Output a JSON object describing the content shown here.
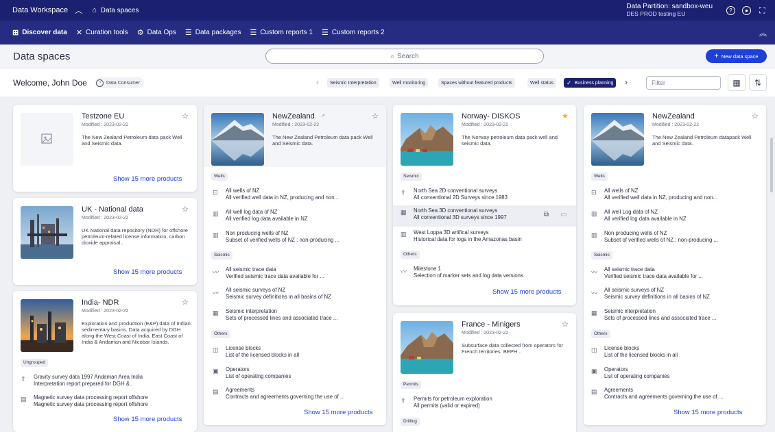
{
  "topbar": {
    "app_name": "Data Workspace",
    "breadcrumb": "Data spaces",
    "partition_line1": "Data Partition: sandbox-weu",
    "partition_line2": "DES PROD testing EU"
  },
  "nav": {
    "items": [
      {
        "label": "Discover data",
        "icon": "grid-icon"
      },
      {
        "label": "Curation tools",
        "icon": "tools-icon"
      },
      {
        "label": "Data Ops",
        "icon": "gears-icon"
      },
      {
        "label": "Data packages",
        "icon": "list-icon"
      },
      {
        "label": "Custom reports 1",
        "icon": "list-icon"
      },
      {
        "label": "Custom reports 2",
        "icon": "list-icon"
      }
    ]
  },
  "header": {
    "title": "Data spaces",
    "search_placeholder": "Search",
    "new_button": "New data space"
  },
  "welcome": {
    "greeting": "Welcome, John Doe",
    "role": "Data Consumer",
    "filter_placeholder": "Filter",
    "chips": [
      "Seismic Interpretation",
      "Well monitoring",
      "Spaces without featured products",
      "Well status",
      "Business planning"
    ]
  },
  "colors": {
    "topbar": "#1b2170",
    "navbar": "#252c82",
    "accent": "#1e3fd8",
    "star_favorite": "#f5b400"
  },
  "cards": {
    "testzone": {
      "title": "Testzone EU",
      "modified": "Modified : 2023-02-22",
      "desc": "The New Zealand Petroleum data pack Well and Seismic data.",
      "show_more": "Show 15 more products"
    },
    "uk": {
      "title": "UK - National data",
      "modified": "Modified : 2023-02-22",
      "desc": "UK National data repository (NDR) for offshore petroleum-related license information, carbon dioxide appraisal..",
      "show_more": "Show 15 more products"
    },
    "india": {
      "title": "India- NDR",
      "modified": "Modified : 2023-02-22",
      "desc": "Exploration and production (E&P) data of Indian sedimentary basins. Data acquired by DGH along the West Coast of India, East Coast of India & Andaman and Nicobar Islands.",
      "section": "Ungrouped",
      "products": [
        {
          "title": "Gravity survey data 1997 Andaman Area India",
          "sub": "Interpretation report prepared for DGH &.."
        },
        {
          "title": "Magnetic survey data processing report offshore",
          "sub": "Magnetic survey data processing report offshore"
        }
      ],
      "show_more": "Show 15 more products"
    },
    "nz1": {
      "title": "NewZealand",
      "modified": "Modified : 2023-02-22",
      "desc": "The New Zealand Petroleum data pack Well and Seismic data.",
      "sections": {
        "wells": "Wells",
        "seismic": "Seismic",
        "others": "Others"
      },
      "wells": [
        {
          "title": "All wells of NZ",
          "sub": "All verified well data in NZ, producing and non..."
        },
        {
          "title": "All well log data of NZ",
          "sub": "All verified log data available in NZ"
        },
        {
          "title": "Non producing wells of NZ",
          "sub": "Subset of verified wells of NZ : non-producing ..."
        }
      ],
      "seismic": [
        {
          "title": "All seismic trace data",
          "sub": "Verified seismic trace data available for ..."
        },
        {
          "title": "All seismic surveys of NZ",
          "sub": "Seismic survey definitions in all basins of NZ"
        },
        {
          "title": "Seismic interpretation",
          "sub": "Sets of processed lines and associated trace ..."
        }
      ],
      "others": [
        {
          "title": "License blocks",
          "sub": "List of the licensed blocks in all"
        },
        {
          "title": "Operators",
          "sub": "List of operating companies"
        },
        {
          "title": "Agreements",
          "sub": "Contracts and agreements governing the use of ..."
        }
      ],
      "show_more": "Show 15 more products"
    },
    "norway": {
      "title": "Norway- DISKOS",
      "modified": "Modified : 2023-02-22",
      "desc": "The Norway petroleum data pack well and seismic data.",
      "sections": {
        "seismic": "Seismic",
        "others": "Others"
      },
      "seismic": [
        {
          "title": "North Sea 2D conventional surveys",
          "sub": "All conventional 2D Surveys since 1983"
        },
        {
          "title": "North Sea 3D conventional surveys",
          "sub": "All conventional 3D surveys since 1997"
        },
        {
          "title": "West Loppa 3D artifical surveys",
          "sub": "Historical data for logs in the Amazonas basin"
        }
      ],
      "others": [
        {
          "title": "Milestone 1",
          "sub": "Selection of marker sets and log data versions"
        }
      ],
      "show_more": "Show 15 more products"
    },
    "france": {
      "title": "France - Minigers",
      "modified": "Modified : 2023-02-22",
      "desc": "Subsurface data collected from operators for French territories. BEPH ..",
      "sections": {
        "permits": "Permits",
        "drilling": "Drilling"
      },
      "permits": [
        {
          "title": "Permits for petroleum exploration",
          "sub": "All permits (valid or expired)"
        }
      ]
    },
    "nz2": {
      "title": "NewZealand",
      "modified": "Modified : 2023-02-22",
      "desc": "The New Zealand Petroleum datapack Well and Seismic data.",
      "sections": {
        "wells": "Wells",
        "seismic": "Seismic",
        "others": "Others"
      },
      "wells": [
        {
          "title": "All wells of NZ",
          "sub": "All verified well data in NZ, producing and non..."
        },
        {
          "title": "All well Log data of NZ",
          "sub": "All verified log data available in NZ"
        },
        {
          "title": "Non producing wells of NZ",
          "sub": "Subset of verified wells of NZ : non-producing ..."
        }
      ],
      "seismic": [
        {
          "title": "All seismic trace data",
          "sub": "Verified seismic trace data available for ..."
        },
        {
          "title": "All seismic surveys of NZ",
          "sub": "Seismic survey definitions in all basins of NZ"
        },
        {
          "title": "Seismic interpretation",
          "sub": "Sets of processed lines and associated trace ..."
        }
      ],
      "others": [
        {
          "title": "License blocks",
          "sub": "List of the licensed blocks in all"
        },
        {
          "title": "Operators",
          "sub": "List of operating companies"
        },
        {
          "title": "Agreements",
          "sub": "Contracts and agreements governing the use of ..."
        }
      ],
      "show_more": "Show 15 more products"
    }
  }
}
